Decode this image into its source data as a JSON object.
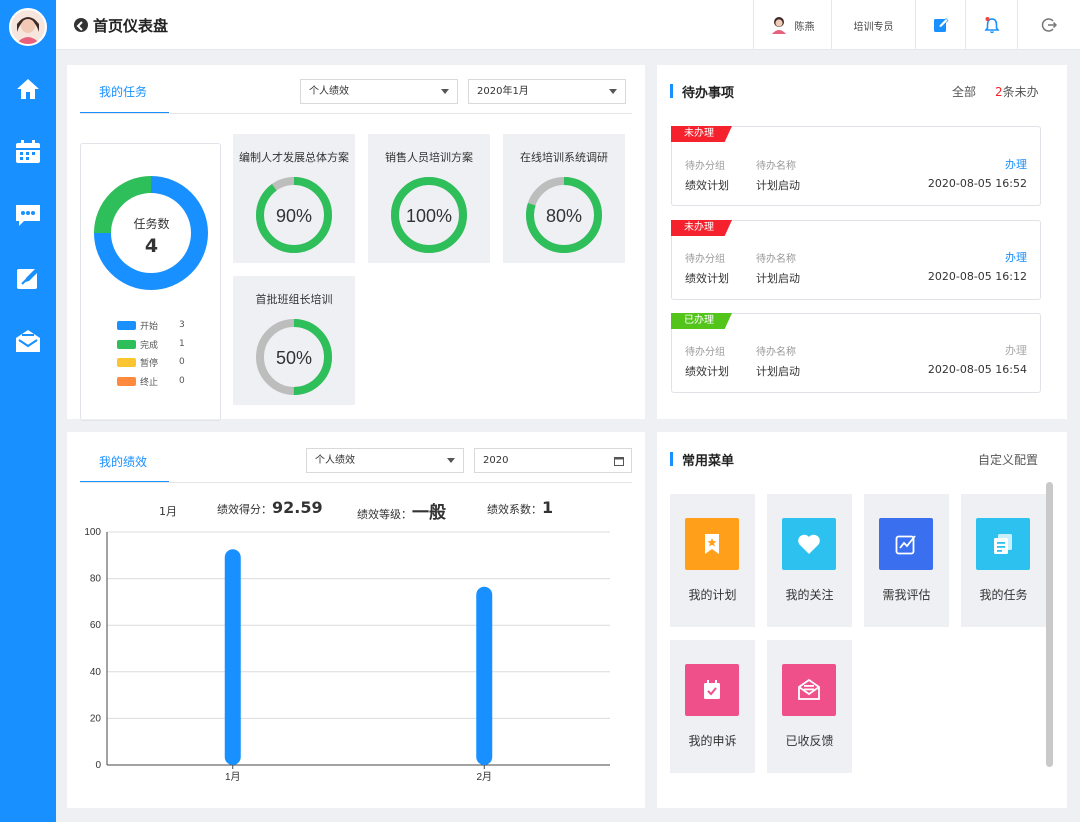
{
  "header": {
    "title": "首页仪表盘",
    "user_name": "陈燕",
    "user_role": "培训专员"
  },
  "sidebar": {
    "items": [
      {
        "icon": "home-icon"
      },
      {
        "icon": "calendar-icon"
      },
      {
        "icon": "message-icon"
      },
      {
        "icon": "edit-icon"
      },
      {
        "icon": "mail-icon"
      }
    ]
  },
  "tasks": {
    "tab_label": "我的任务",
    "filter_select": "个人绩效",
    "month_select": "2020年1月",
    "summary": {
      "label": "任务数",
      "count": "4"
    },
    "legend": [
      {
        "name": "开始",
        "count": "3",
        "color": "#1890ff"
      },
      {
        "name": "完成",
        "count": "1",
        "color": "#2fbf5a"
      },
      {
        "name": "暂停",
        "count": "0",
        "color": "#fbc531"
      },
      {
        "name": "终止",
        "count": "0",
        "color": "#ff8a3d"
      }
    ],
    "cards": [
      {
        "title": "编制人才发展总体方案",
        "percent": 90,
        "label": "90%"
      },
      {
        "title": "销售人员培训方案",
        "percent": 100,
        "label": "100%"
      },
      {
        "title": "在线培训系统调研",
        "percent": 80,
        "label": "80%"
      },
      {
        "title": "首批班组长培训",
        "percent": 50,
        "label": "50%"
      }
    ]
  },
  "todo": {
    "title": "待办事项",
    "all_label": "全部",
    "pending_count": "2",
    "pending_suffix": "条未办",
    "items": [
      {
        "status": "未办理",
        "group_label": "待办分组",
        "name_label": "待办名称",
        "group": "绩效计划",
        "name": "计划启动",
        "action": "办理",
        "time": "2020-08-05 16:52"
      },
      {
        "status": "未办理",
        "group_label": "待办分组",
        "name_label": "待办名称",
        "group": "绩效计划",
        "name": "计划启动",
        "action": "办理",
        "time": "2020-08-05 16:12"
      },
      {
        "status": "已办理",
        "group_label": "待办分组",
        "name_label": "待办名称",
        "group": "绩效计划",
        "name": "计划启动",
        "action": "办理",
        "time": "2020-08-05 16:54"
      }
    ]
  },
  "performance": {
    "tab_label": "我的绩效",
    "filter_select": "个人绩效",
    "year_input": "2020",
    "month": "1月",
    "score_label": "绩效得分：",
    "score": "92.59",
    "grade_label": "绩效等级：",
    "grade": "一般",
    "coef_label": "绩效系数：",
    "coef": "1"
  },
  "chart_data": {
    "type": "bar",
    "categories": [
      "1月",
      "2月"
    ],
    "values": [
      92.59,
      76.5
    ],
    "ylim": [
      0,
      100
    ],
    "yticks": [
      "0",
      "20",
      "40",
      "60",
      "80",
      "100"
    ],
    "grid": true,
    "color": "#1890ff"
  },
  "menu": {
    "title": "常用菜单",
    "config_label": "自定义配置",
    "items": [
      {
        "label": "我的计划",
        "icon": "bookmark-icon",
        "color": "#ff9f1a"
      },
      {
        "label": "我的关注",
        "icon": "heart-icon",
        "color": "#2dc1f0"
      },
      {
        "label": "需我评估",
        "icon": "evaluate-icon",
        "color": "#3a6ff0"
      },
      {
        "label": "我的任务",
        "icon": "task-icon",
        "color": "#2dc1f0"
      },
      {
        "label": "我的申诉",
        "icon": "appeal-icon",
        "color": "#f0508a"
      },
      {
        "label": "已收反馈",
        "icon": "feedback-icon",
        "color": "#f0508a"
      }
    ]
  }
}
